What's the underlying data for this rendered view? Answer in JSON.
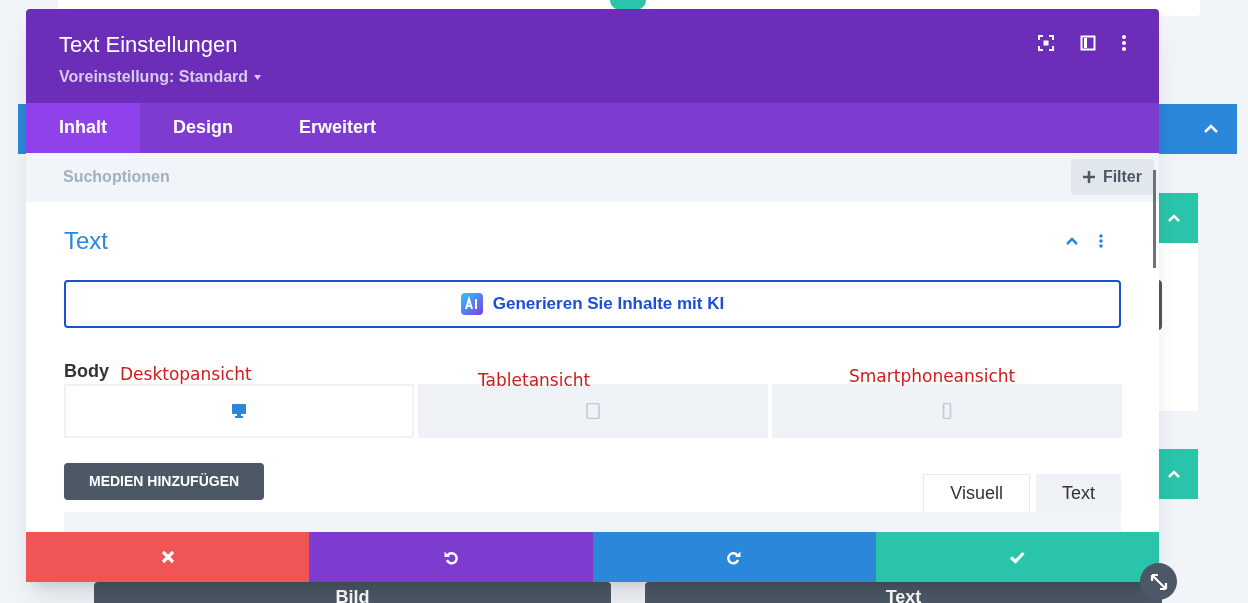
{
  "background": {
    "bottom_buttons": [
      "Bild",
      "Text"
    ]
  },
  "modal": {
    "title": "Text Einstellungen",
    "preset": "Voreinstellung: Standard",
    "tabs": [
      {
        "label": "Inhalt",
        "selected": true
      },
      {
        "label": "Design",
        "selected": false
      },
      {
        "label": "Erweitert",
        "selected": false
      }
    ],
    "search": {
      "placeholder": "Suchoptionen"
    },
    "filter_button": "Filter",
    "section": {
      "title": "Text",
      "expanded": true
    },
    "ai_button": "Generieren Sie Inhalte mit KI",
    "field_label": "Body",
    "device_tabs": [
      {
        "kind": "desktop",
        "selected": true,
        "annotation": "Desktopansicht"
      },
      {
        "kind": "tablet",
        "selected": false,
        "annotation": "Tabletansicht"
      },
      {
        "kind": "phone",
        "selected": false,
        "annotation": "Smartphoneansicht"
      }
    ],
    "media_button": "MEDIEN HINZUFÜGEN",
    "editor_tabs": [
      {
        "label": "Visuell",
        "selected": true
      },
      {
        "label": "Text",
        "selected": false
      }
    ],
    "actions": [
      {
        "kind": "cancel"
      },
      {
        "kind": "undo"
      },
      {
        "kind": "redo"
      },
      {
        "kind": "save"
      }
    ]
  }
}
